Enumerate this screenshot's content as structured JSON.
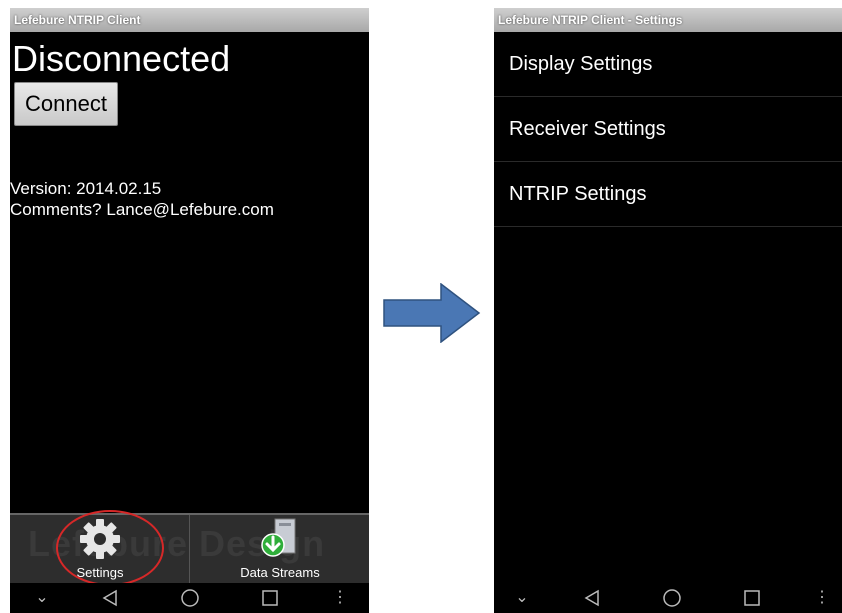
{
  "left_screen": {
    "title": "Lefebure NTRIP Client",
    "status": "Disconnected",
    "connect_label": "Connect",
    "version": "Version: 2014.02.15",
    "comments": "Comments? Lance@Lefebure.com",
    "watermark": "Lefebure Design",
    "tabs": [
      {
        "label": "Settings",
        "icon": "gear-icon"
      },
      {
        "label": "Data Streams",
        "icon": "download-icon"
      }
    ]
  },
  "right_screen": {
    "title": "Lefebure NTRIP Client - Settings",
    "items": [
      {
        "label": "Display Settings"
      },
      {
        "label": "Receiver Settings"
      },
      {
        "label": "NTRIP Settings"
      }
    ]
  },
  "navbar": [
    "chevron-down-icon",
    "back-icon",
    "home-icon",
    "recents-icon",
    "menu-dots-icon"
  ],
  "colors": {
    "highlight": "#d62828",
    "arrow": "#4a77b4",
    "titlebar": "#b5b5b5",
    "background": "#000000"
  }
}
